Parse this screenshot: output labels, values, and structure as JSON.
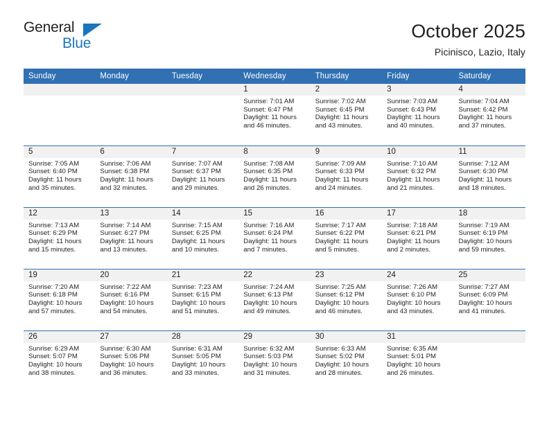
{
  "brand": {
    "name_top": "General",
    "name_bottom": "Blue",
    "accent_color": "#1b75bb"
  },
  "header": {
    "month_title": "October 2025",
    "location": "Picinisco, Lazio, Italy"
  },
  "theme": {
    "header_blue": "#3070b3",
    "daynum_background": "#f1f1f1",
    "text_color": "#231f20"
  },
  "calendar": {
    "weekday_headers": [
      "Sunday",
      "Monday",
      "Tuesday",
      "Wednesday",
      "Thursday",
      "Friday",
      "Saturday"
    ],
    "weeks": [
      [
        {
          "day": "",
          "sunrise": "",
          "sunset": "",
          "daylight_line1": "",
          "daylight_line2": ""
        },
        {
          "day": "",
          "sunrise": "",
          "sunset": "",
          "daylight_line1": "",
          "daylight_line2": ""
        },
        {
          "day": "",
          "sunrise": "",
          "sunset": "",
          "daylight_line1": "",
          "daylight_line2": ""
        },
        {
          "day": "1",
          "sunrise": "Sunrise: 7:01 AM",
          "sunset": "Sunset: 6:47 PM",
          "daylight_line1": "Daylight: 11 hours",
          "daylight_line2": "and 46 minutes."
        },
        {
          "day": "2",
          "sunrise": "Sunrise: 7:02 AM",
          "sunset": "Sunset: 6:45 PM",
          "daylight_line1": "Daylight: 11 hours",
          "daylight_line2": "and 43 minutes."
        },
        {
          "day": "3",
          "sunrise": "Sunrise: 7:03 AM",
          "sunset": "Sunset: 6:43 PM",
          "daylight_line1": "Daylight: 11 hours",
          "daylight_line2": "and 40 minutes."
        },
        {
          "day": "4",
          "sunrise": "Sunrise: 7:04 AM",
          "sunset": "Sunset: 6:42 PM",
          "daylight_line1": "Daylight: 11 hours",
          "daylight_line2": "and 37 minutes."
        }
      ],
      [
        {
          "day": "5",
          "sunrise": "Sunrise: 7:05 AM",
          "sunset": "Sunset: 6:40 PM",
          "daylight_line1": "Daylight: 11 hours",
          "daylight_line2": "and 35 minutes."
        },
        {
          "day": "6",
          "sunrise": "Sunrise: 7:06 AM",
          "sunset": "Sunset: 6:38 PM",
          "daylight_line1": "Daylight: 11 hours",
          "daylight_line2": "and 32 minutes."
        },
        {
          "day": "7",
          "sunrise": "Sunrise: 7:07 AM",
          "sunset": "Sunset: 6:37 PM",
          "daylight_line1": "Daylight: 11 hours",
          "daylight_line2": "and 29 minutes."
        },
        {
          "day": "8",
          "sunrise": "Sunrise: 7:08 AM",
          "sunset": "Sunset: 6:35 PM",
          "daylight_line1": "Daylight: 11 hours",
          "daylight_line2": "and 26 minutes."
        },
        {
          "day": "9",
          "sunrise": "Sunrise: 7:09 AM",
          "sunset": "Sunset: 6:33 PM",
          "daylight_line1": "Daylight: 11 hours",
          "daylight_line2": "and 24 minutes."
        },
        {
          "day": "10",
          "sunrise": "Sunrise: 7:10 AM",
          "sunset": "Sunset: 6:32 PM",
          "daylight_line1": "Daylight: 11 hours",
          "daylight_line2": "and 21 minutes."
        },
        {
          "day": "11",
          "sunrise": "Sunrise: 7:12 AM",
          "sunset": "Sunset: 6:30 PM",
          "daylight_line1": "Daylight: 11 hours",
          "daylight_line2": "and 18 minutes."
        }
      ],
      [
        {
          "day": "12",
          "sunrise": "Sunrise: 7:13 AM",
          "sunset": "Sunset: 6:29 PM",
          "daylight_line1": "Daylight: 11 hours",
          "daylight_line2": "and 15 minutes."
        },
        {
          "day": "13",
          "sunrise": "Sunrise: 7:14 AM",
          "sunset": "Sunset: 6:27 PM",
          "daylight_line1": "Daylight: 11 hours",
          "daylight_line2": "and 13 minutes."
        },
        {
          "day": "14",
          "sunrise": "Sunrise: 7:15 AM",
          "sunset": "Sunset: 6:25 PM",
          "daylight_line1": "Daylight: 11 hours",
          "daylight_line2": "and 10 minutes."
        },
        {
          "day": "15",
          "sunrise": "Sunrise: 7:16 AM",
          "sunset": "Sunset: 6:24 PM",
          "daylight_line1": "Daylight: 11 hours",
          "daylight_line2": "and 7 minutes."
        },
        {
          "day": "16",
          "sunrise": "Sunrise: 7:17 AM",
          "sunset": "Sunset: 6:22 PM",
          "daylight_line1": "Daylight: 11 hours",
          "daylight_line2": "and 5 minutes."
        },
        {
          "day": "17",
          "sunrise": "Sunrise: 7:18 AM",
          "sunset": "Sunset: 6:21 PM",
          "daylight_line1": "Daylight: 11 hours",
          "daylight_line2": "and 2 minutes."
        },
        {
          "day": "18",
          "sunrise": "Sunrise: 7:19 AM",
          "sunset": "Sunset: 6:19 PM",
          "daylight_line1": "Daylight: 10 hours",
          "daylight_line2": "and 59 minutes."
        }
      ],
      [
        {
          "day": "19",
          "sunrise": "Sunrise: 7:20 AM",
          "sunset": "Sunset: 6:18 PM",
          "daylight_line1": "Daylight: 10 hours",
          "daylight_line2": "and 57 minutes."
        },
        {
          "day": "20",
          "sunrise": "Sunrise: 7:22 AM",
          "sunset": "Sunset: 6:16 PM",
          "daylight_line1": "Daylight: 10 hours",
          "daylight_line2": "and 54 minutes."
        },
        {
          "day": "21",
          "sunrise": "Sunrise: 7:23 AM",
          "sunset": "Sunset: 6:15 PM",
          "daylight_line1": "Daylight: 10 hours",
          "daylight_line2": "and 51 minutes."
        },
        {
          "day": "22",
          "sunrise": "Sunrise: 7:24 AM",
          "sunset": "Sunset: 6:13 PM",
          "daylight_line1": "Daylight: 10 hours",
          "daylight_line2": "and 49 minutes."
        },
        {
          "day": "23",
          "sunrise": "Sunrise: 7:25 AM",
          "sunset": "Sunset: 6:12 PM",
          "daylight_line1": "Daylight: 10 hours",
          "daylight_line2": "and 46 minutes."
        },
        {
          "day": "24",
          "sunrise": "Sunrise: 7:26 AM",
          "sunset": "Sunset: 6:10 PM",
          "daylight_line1": "Daylight: 10 hours",
          "daylight_line2": "and 43 minutes."
        },
        {
          "day": "25",
          "sunrise": "Sunrise: 7:27 AM",
          "sunset": "Sunset: 6:09 PM",
          "daylight_line1": "Daylight: 10 hours",
          "daylight_line2": "and 41 minutes."
        }
      ],
      [
        {
          "day": "26",
          "sunrise": "Sunrise: 6:29 AM",
          "sunset": "Sunset: 5:07 PM",
          "daylight_line1": "Daylight: 10 hours",
          "daylight_line2": "and 38 minutes."
        },
        {
          "day": "27",
          "sunrise": "Sunrise: 6:30 AM",
          "sunset": "Sunset: 5:06 PM",
          "daylight_line1": "Daylight: 10 hours",
          "daylight_line2": "and 36 minutes."
        },
        {
          "day": "28",
          "sunrise": "Sunrise: 6:31 AM",
          "sunset": "Sunset: 5:05 PM",
          "daylight_line1": "Daylight: 10 hours",
          "daylight_line2": "and 33 minutes."
        },
        {
          "day": "29",
          "sunrise": "Sunrise: 6:32 AM",
          "sunset": "Sunset: 5:03 PM",
          "daylight_line1": "Daylight: 10 hours",
          "daylight_line2": "and 31 minutes."
        },
        {
          "day": "30",
          "sunrise": "Sunrise: 6:33 AM",
          "sunset": "Sunset: 5:02 PM",
          "daylight_line1": "Daylight: 10 hours",
          "daylight_line2": "and 28 minutes."
        },
        {
          "day": "31",
          "sunrise": "Sunrise: 6:35 AM",
          "sunset": "Sunset: 5:01 PM",
          "daylight_line1": "Daylight: 10 hours",
          "daylight_line2": "and 26 minutes."
        },
        {
          "day": "",
          "sunrise": "",
          "sunset": "",
          "daylight_line1": "",
          "daylight_line2": ""
        }
      ]
    ]
  }
}
